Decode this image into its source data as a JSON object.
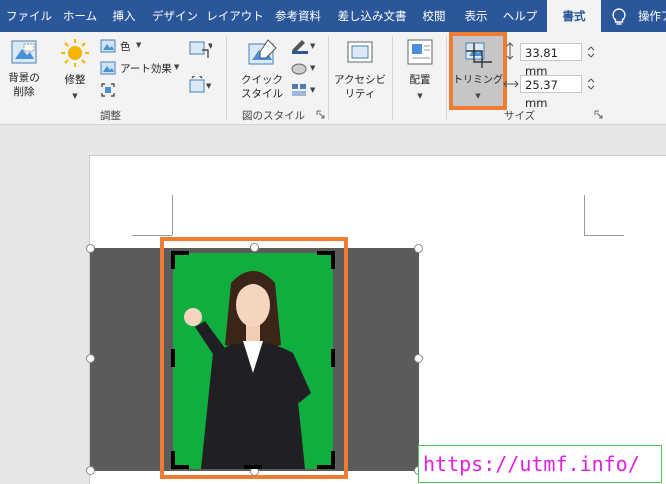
{
  "tabs": [
    {
      "label": "ファイル",
      "active": false
    },
    {
      "label": "ホーム",
      "active": false
    },
    {
      "label": "挿入",
      "active": false
    },
    {
      "label": "デザイン",
      "active": false
    },
    {
      "label": "レイアウト",
      "active": false
    },
    {
      "label": "参考資料",
      "active": false
    },
    {
      "label": "差し込み文書",
      "active": false
    },
    {
      "label": "校閲",
      "active": false
    },
    {
      "label": "表示",
      "active": false
    },
    {
      "label": "ヘルプ",
      "active": false
    },
    {
      "label": "書式",
      "active": true
    }
  ],
  "tell_me": {
    "label": "操作ア",
    "icon": "lightbulb-icon"
  },
  "ribbon": {
    "adjust": {
      "remove_bg_line1": "背景の",
      "remove_bg_line2": "削除",
      "corrections": "修整",
      "color": "色",
      "artistic": "アート効果",
      "group_label": "調整"
    },
    "picture_styles": {
      "quick_style_line1": "クイック",
      "quick_style_line2": "スタイル",
      "group_label": "図のスタイル"
    },
    "accessibility": {
      "line1": "アクセシビ",
      "line2": "リティ"
    },
    "arrange": {
      "position": "配置"
    },
    "size": {
      "crop": "トリミング",
      "height": "33.81 mm",
      "width": "25.37 mm",
      "group_label": "サイズ"
    }
  },
  "watermark": "https://utmf.info/",
  "colors": {
    "tab_bar": "#2b579a",
    "ribbon_bg": "#f3f3f3",
    "highlight_orange": "#ed7d31",
    "green_screen": "#0fae3f",
    "crop_gray": "#5b5b5b",
    "watermark_text": "#e020e0"
  }
}
